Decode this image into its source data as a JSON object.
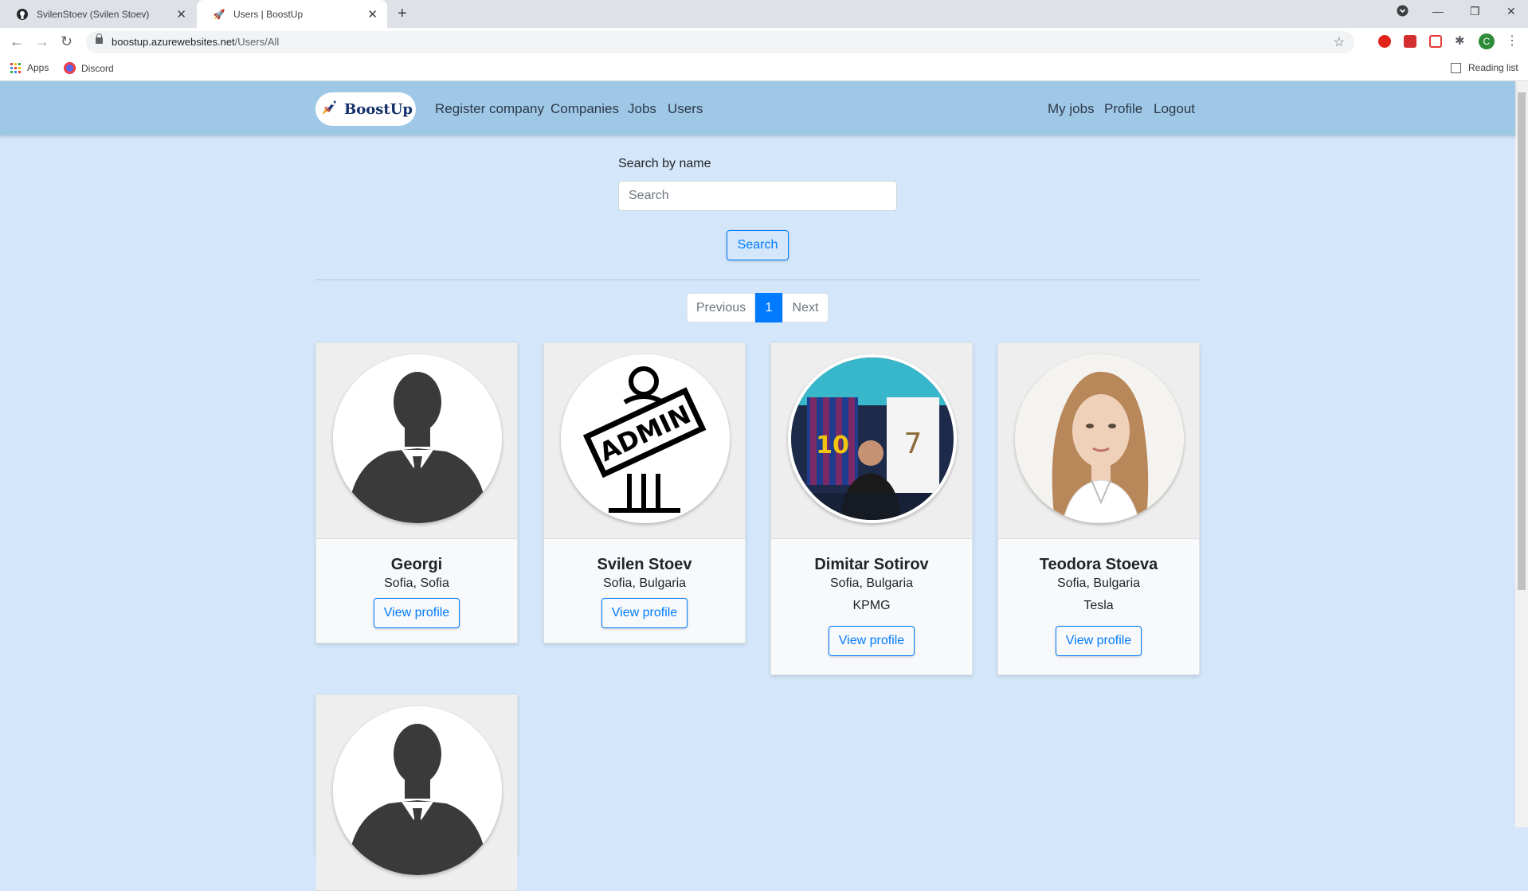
{
  "browser": {
    "tabs": [
      {
        "title": "SvilenStoev (Svilen Stoev)",
        "icon": "github-icon"
      },
      {
        "title": "Users | BoostUp",
        "icon": "rocket-icon"
      }
    ],
    "url_host": "boostup.azurewebsites.net",
    "url_path": "/Users/All",
    "bookmarks": [
      "Apps",
      "Discord"
    ],
    "reading_list": "Reading list",
    "profile_initial": "C"
  },
  "navbar": {
    "brand": "BoostUp",
    "left_links": [
      "Register company",
      "Companies",
      "Jobs",
      "Users"
    ],
    "right_links": [
      "My jobs",
      "Profile",
      "Logout"
    ]
  },
  "search": {
    "label": "Search by name",
    "placeholder": "Search",
    "value": "",
    "button": "Search"
  },
  "pagination": {
    "previous": "Previous",
    "current": "1",
    "next": "Next"
  },
  "users": [
    {
      "name": "Georgi",
      "location": "Sofia, Sofia",
      "company": "",
      "avatar": "silhouette-avatar-icon",
      "button": "View profile"
    },
    {
      "name": "Svilen Stoev",
      "location": "Sofia, Bulgaria",
      "company": "",
      "avatar": "admin-sign-avatar-icon",
      "button": "View profile"
    },
    {
      "name": "Dimitar Sotirov",
      "location": "Sofia, Bulgaria",
      "company": "KPMG",
      "avatar": "photo-avatar",
      "button": "View profile"
    },
    {
      "name": "Teodora Stoeva",
      "location": "Sofia, Bulgaria",
      "company": "Tesla",
      "avatar": "photo-avatar",
      "button": "View profile"
    },
    {
      "name": "",
      "location": "",
      "company": "",
      "avatar": "silhouette-avatar-icon",
      "button": ""
    }
  ],
  "colors": {
    "accent": "#007bff",
    "navbar": "#9fc7e6",
    "page_bg": "#d4e6fa"
  }
}
